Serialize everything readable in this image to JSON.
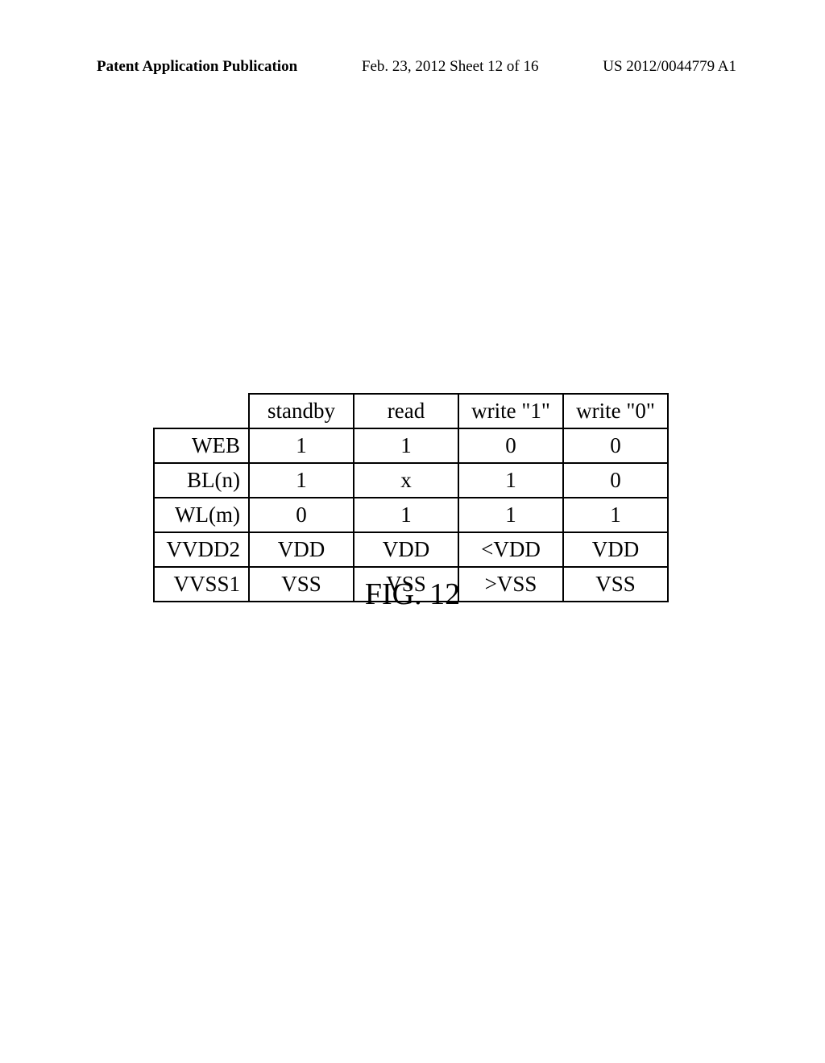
{
  "header": {
    "left": "Patent Application Publication",
    "center": "Feb. 23, 2012  Sheet 12 of 16",
    "right": "US 2012/0044779 A1"
  },
  "chart_data": {
    "type": "table",
    "columns": [
      "standby",
      "read",
      "write \"1\"",
      "write \"0\""
    ],
    "rows": [
      "WEB",
      "BL(n)",
      "WL(m)",
      "VVDD2",
      "VVSS1"
    ],
    "data": [
      [
        "1",
        "1",
        "0",
        "0"
      ],
      [
        "1",
        "x",
        "1",
        "0"
      ],
      [
        "0",
        "1",
        "1",
        "1"
      ],
      [
        "VDD",
        "VDD",
        "<VDD",
        "VDD"
      ],
      [
        "VSS",
        "VSS",
        ">VSS",
        "VSS"
      ]
    ],
    "title": "FIG. 12"
  }
}
